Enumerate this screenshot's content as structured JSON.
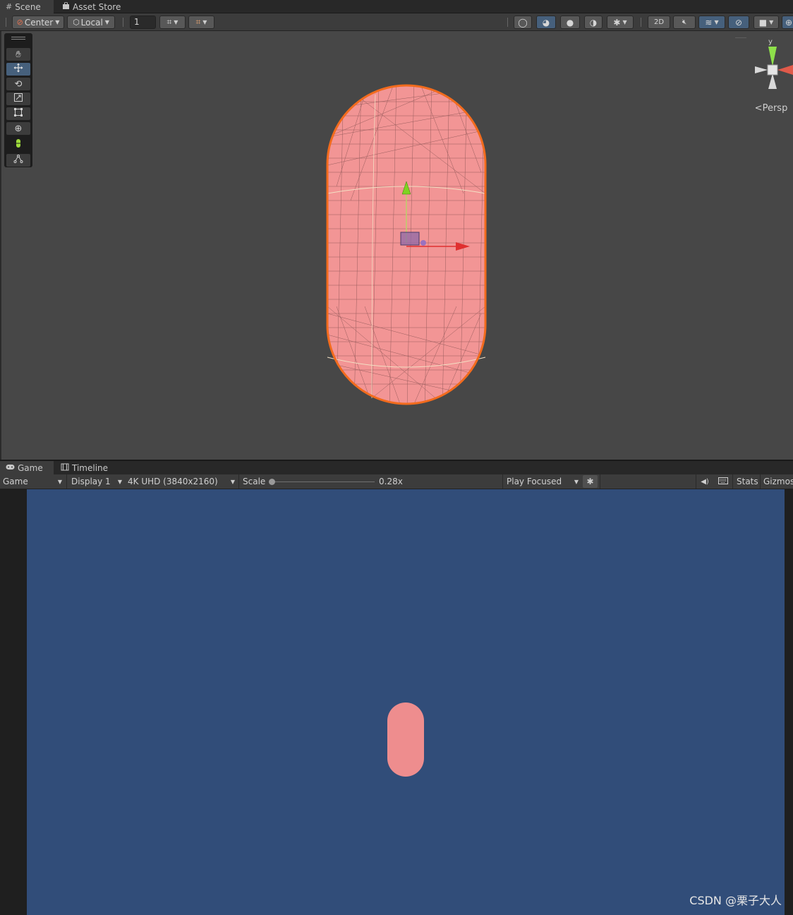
{
  "scene_window": {
    "tabs": [
      {
        "label": "Scene",
        "icon": "grid-icon"
      },
      {
        "label": "Asset Store",
        "icon": "bag-icon"
      }
    ],
    "toolbar": {
      "pivot_mode": "Center",
      "pivot_rotation": "Local",
      "grid_snap_value": "1",
      "mode_2d_label": "2D"
    },
    "tools": [
      "hand",
      "move",
      "rotate",
      "scale",
      "rect",
      "transform",
      "capsule-collider-edit",
      "path-edit"
    ],
    "active_tool": "move",
    "view": {
      "projection_label": "Persp",
      "axis_y_label": "y",
      "background_color": "#474747",
      "selection_outline_color": "#f26b1d",
      "capsule_color": "#ee8d8e"
    }
  },
  "game_window": {
    "tabs": [
      {
        "label": "Game",
        "icon": "gamepad-icon"
      },
      {
        "label": "Timeline",
        "icon": "film-icon"
      }
    ],
    "toolbar": {
      "view_mode": "Game",
      "display": "Display 1",
      "resolution": "4K UHD (3840x2160)",
      "scale_label": "Scale",
      "scale_value": "0.28x",
      "scale_fraction": 0.0,
      "play_mode": "Play Focused",
      "stats_label": "Stats",
      "gizmos_label": "Gizmos"
    },
    "view": {
      "background_color": "#314d79",
      "capsule_color": "#ee8d8e"
    }
  },
  "watermark": "CSDN @栗子大人"
}
